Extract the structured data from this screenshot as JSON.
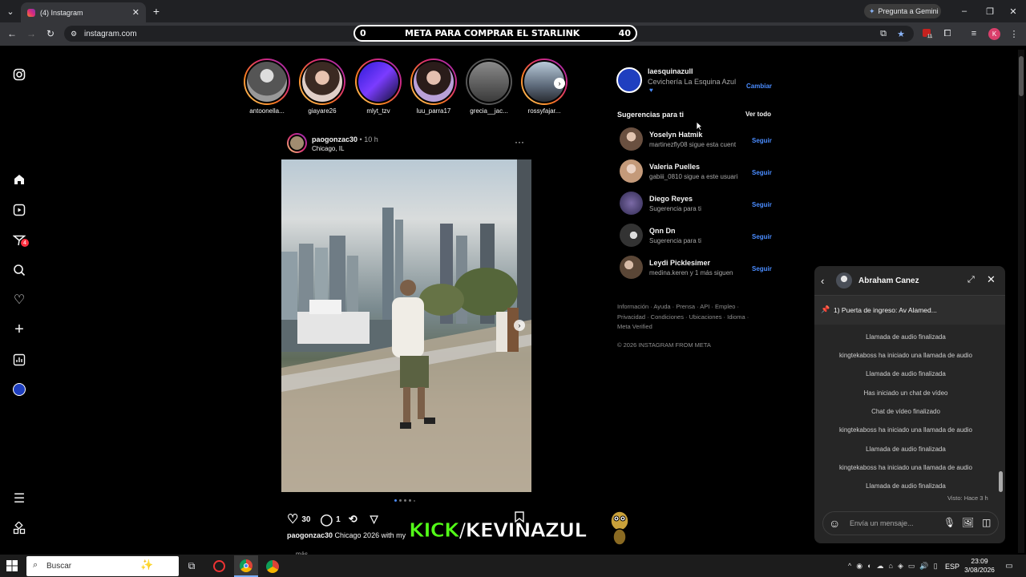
{
  "browser": {
    "tab_title": "(4) Instagram",
    "url": "instagram.com",
    "gemini_label": "Pregunta a Gemini",
    "ext_badge": "11",
    "profile_initial": "K"
  },
  "overlay": {
    "left_num": "0",
    "title": "META PARA COMPRAR EL STARLINK",
    "right_num": "40",
    "kick_a": "KICK",
    "kick_b": "/KEVINAZUL"
  },
  "nav": {
    "messages_badge": "4"
  },
  "stories": [
    {
      "name": "antoonella..."
    },
    {
      "name": "giayare26"
    },
    {
      "name": "mlyt_tzv"
    },
    {
      "name": "luu_parra17"
    },
    {
      "name": "grecia__jac..."
    },
    {
      "name": "rossyfajar..."
    }
  ],
  "post": {
    "username": "paogonzac30",
    "time": "10 h",
    "location": "Chicago, IL",
    "likes": "30",
    "comments": "1",
    "caption_user": "paogonzac30",
    "caption_text": "Chicago 2026 with my",
    "more": "... más"
  },
  "account": {
    "username": "laesquinazull",
    "fullname": "Cevichería La Esquina Azul",
    "switch": "Cambiar"
  },
  "suggestions": {
    "title": "Sugerencias para ti",
    "see_all": "Ver todo",
    "follow_label": "Seguir",
    "items": [
      {
        "name": "Yoselyn Hatmik",
        "sub": "martinezfly08 sigue esta cuent"
      },
      {
        "name": "Valeria Puelles",
        "sub": "gabiii_0810 sigue a este usuari"
      },
      {
        "name": "Diego Reyes",
        "sub": "Sugerencia para ti"
      },
      {
        "name": "Qnn Dn",
        "sub": "Sugerencia para ti"
      },
      {
        "name": "Leydi Picklesimer",
        "sub": "medina.keren y 1 más siguen"
      }
    ]
  },
  "footer": {
    "line1": "Información · Ayuda · Prensa · API · Empleo ·",
    "line2": "Privacidad · Condiciones · Ubicaciones · Idioma ·",
    "line3": "Meta Verified",
    "copy": "© 2026 INSTAGRAM FROM META"
  },
  "chat": {
    "name": "Abraham Canez",
    "pinned": "1) Puerta de ingreso: Av Alamed...",
    "messages": [
      "Llamada de audio finalizada",
      "kingtekaboss ha iniciado una llamada de audio",
      "Llamada de audio finalizada",
      "Has iniciado un chat de vídeo",
      "Chat de vídeo finalizado",
      "kingtekaboss ha iniciado una llamada de audio",
      "Llamada de audio finalizada",
      "kingtekaboss ha iniciado una llamada de audio",
      "Llamada de audio finalizada"
    ],
    "seen": "Visto: Hace 3 h",
    "input_placeholder": "Envía un mensaje..."
  },
  "taskbar": {
    "search": "Buscar",
    "lang": "ESP",
    "time": "23:09",
    "date": "3/08/2026"
  }
}
